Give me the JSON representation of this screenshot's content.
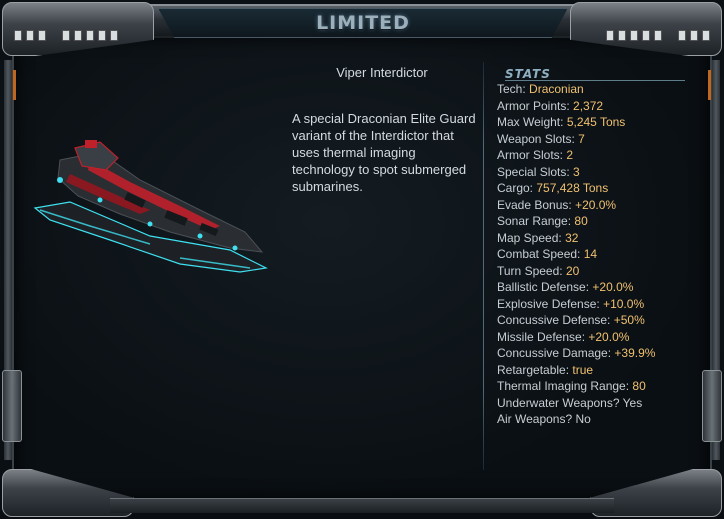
{
  "window": {
    "title": "LIMITED"
  },
  "item": {
    "name": "Viper Interdictor",
    "description": "A special Draconian Elite Guard variant of the Interdictor that uses thermal imaging technology to spot submerged submarines.",
    "image_icon": "ship-icon"
  },
  "stats": {
    "heading": "STATS",
    "rows": [
      {
        "label": "Tech:",
        "value": "Draconian"
      },
      {
        "label": "Armor Points:",
        "value": "2,372"
      },
      {
        "label": "Max Weight:",
        "value": "5,245 Tons"
      },
      {
        "label": "Weapon Slots:",
        "value": "7"
      },
      {
        "label": "Armor Slots:",
        "value": "2"
      },
      {
        "label": "Special Slots:",
        "value": "3"
      },
      {
        "label": "Cargo:",
        "value": "757,428 Tons"
      },
      {
        "label": "Evade Bonus:",
        "value": "+20.0%"
      },
      {
        "label": "Sonar Range:",
        "value": "80"
      },
      {
        "label": "Map Speed:",
        "value": "32"
      },
      {
        "label": "Combat Speed:",
        "value": "14"
      },
      {
        "label": "Turn Speed:",
        "value": "20"
      },
      {
        "label": "Ballistic Defense:",
        "value": "+20.0%"
      },
      {
        "label": "Explosive Defense:",
        "value": "+10.0%"
      },
      {
        "label": "Concussive Defense:",
        "value": "+50%"
      },
      {
        "label": "Missile Defense:",
        "value": "+20.0%"
      },
      {
        "label": "Concussive Damage:",
        "value": "+39.9%"
      },
      {
        "label": "Retargetable:",
        "value": "true"
      },
      {
        "label": "Thermal Imaging Range:",
        "value": "80"
      },
      {
        "label": "Underwater Weapons?",
        "value": "Yes"
      },
      {
        "label": "Air Weapons?",
        "value": "No"
      }
    ]
  },
  "colors": {
    "label": "#c6ced4",
    "value": "#f0c070",
    "frame_accent": "#c2661e",
    "ship_glow": "#3fe0f0",
    "ship_red": "#c0202a"
  }
}
